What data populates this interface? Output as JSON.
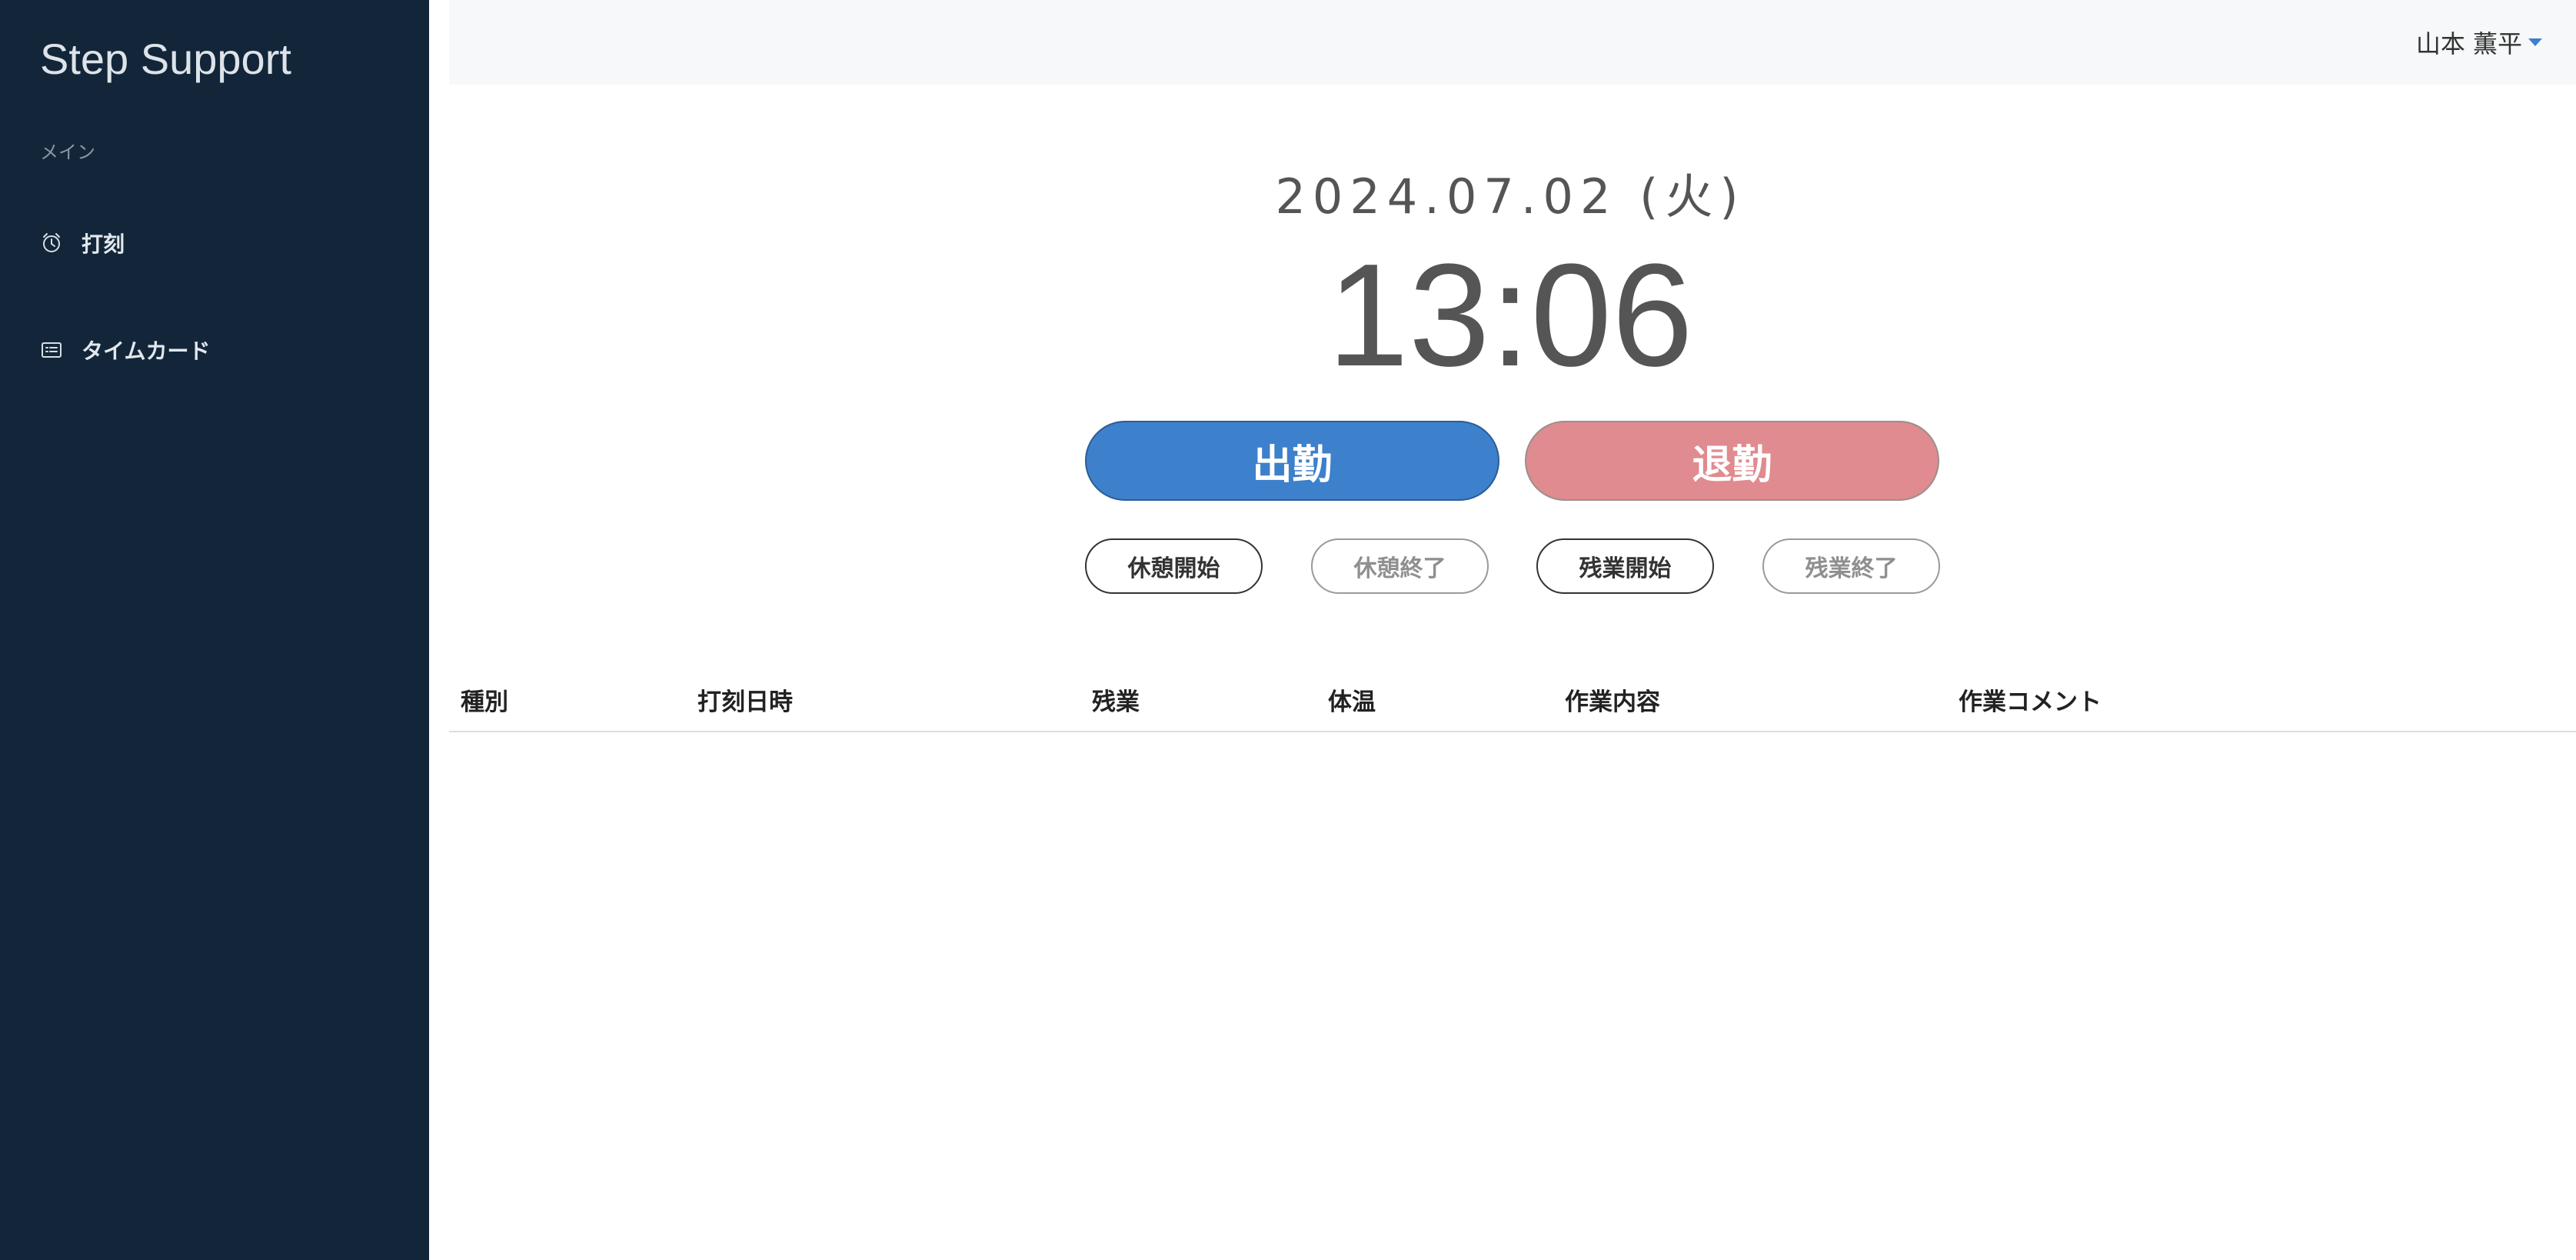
{
  "sidebar": {
    "brand": "Step Support",
    "section_label": "メイン",
    "items": [
      {
        "label": "打刻",
        "icon": "alarm-clock-icon"
      },
      {
        "label": "タイムカード",
        "icon": "card-list-icon"
      }
    ]
  },
  "header": {
    "user_name": "山本 薫平",
    "dropdown_icon": "caret-down-icon"
  },
  "clock": {
    "date": "2024.07.02 (火)",
    "time": "13:06"
  },
  "actions": {
    "clock_in": "出勤",
    "clock_out": "退勤",
    "break_start": "休憩開始",
    "break_end": "休憩終了",
    "overtime_start": "残業開始",
    "overtime_end": "残業終了"
  },
  "table": {
    "columns": [
      "種別",
      "打刻日時",
      "残業",
      "体温",
      "作業内容",
      "作業コメント"
    ],
    "rows": []
  },
  "colors": {
    "sidebar_bg": "#132639",
    "clock_in": "#3d80cc",
    "clock_out": "#e08b8f",
    "accent": "#3d7fd0"
  }
}
